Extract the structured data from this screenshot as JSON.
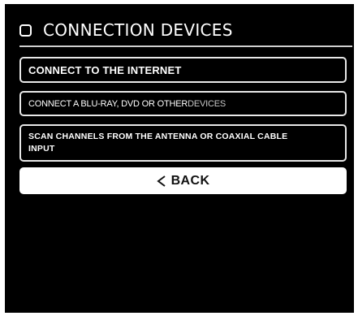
{
  "header": {
    "title": "CONNECTION DEVICES"
  },
  "menu": {
    "items": [
      {
        "label": "CONNECT TO THE INTERNET"
      },
      {
        "label_main": "CONNECT A  BLU-RAY, DVD OR OTHER ",
        "label_tail": "DEVICES"
      },
      {
        "label": "SCAN CHANNELS FROM THE ANTENNA OR COAXIAL CABLE INPUT"
      }
    ]
  },
  "back": {
    "label": "BACK",
    "icon": "chevron-left-icon"
  },
  "colors": {
    "background": "#000000",
    "text": "#ffffff",
    "button_fill": "#ffffff",
    "border": "#e8e8e8"
  }
}
